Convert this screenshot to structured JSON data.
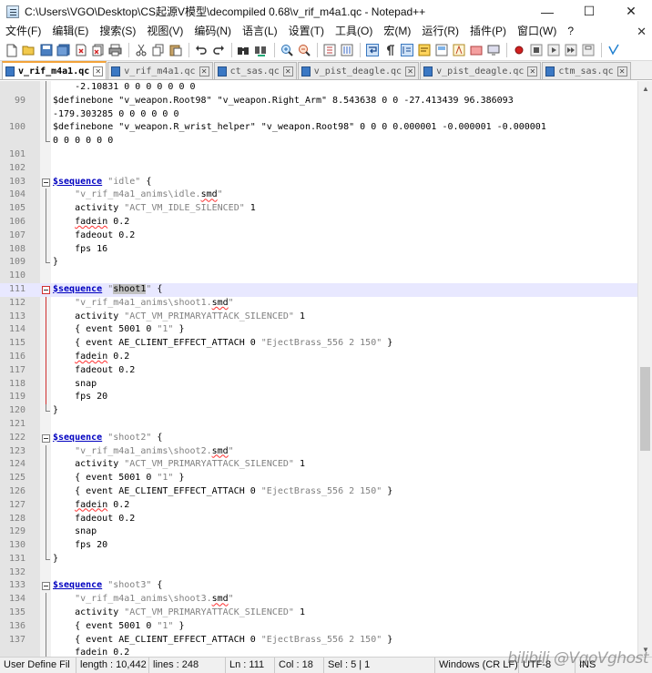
{
  "window": {
    "title": "C:\\Users\\VGO\\Desktop\\CS起源V模型\\decompiled 0.68\\v_rif_m4a1.qc - Notepad++",
    "minimize_glyph": "—",
    "maximize_glyph": "☐",
    "close_glyph": "✕"
  },
  "menu": {
    "items": [
      "文件(F)",
      "编辑(E)",
      "搜索(S)",
      "视图(V)",
      "编码(N)",
      "语言(L)",
      "设置(T)",
      "工具(O)",
      "宏(M)",
      "运行(R)",
      "插件(P)",
      "窗口(W)",
      "?"
    ],
    "close_glyph": "✕"
  },
  "toolbar": {
    "icons": [
      "new-file-icon",
      "open-file-icon",
      "save-icon",
      "save-all-icon",
      "close-icon",
      "close-all-icon",
      "print-icon",
      "cut-icon",
      "copy-icon",
      "paste-icon",
      "undo-icon",
      "redo-icon",
      "find-icon",
      "replace-icon",
      "zoom-in-icon",
      "zoom-out-icon",
      "sync-vertical-icon",
      "sync-horizontal-icon",
      "word-wrap-icon",
      "show-all-chars-icon",
      "indent-guide-icon",
      "user-lang-icon",
      "doc-map-icon",
      "function-list-icon",
      "folder-workspace-icon",
      "monitor-icon",
      "record-macro-icon",
      "stop-macro-icon",
      "play-macro-icon",
      "run-macro-multiple-icon",
      "save-macro-icon",
      "spellcheck-icon"
    ]
  },
  "tabs": [
    {
      "label": "v_rif_m4a1.qc",
      "active": true
    },
    {
      "label": "v_rif_m4a1.qc",
      "active": false
    },
    {
      "label": "ct_sas.qc",
      "active": false
    },
    {
      "label": "v_pist_deagle.qc",
      "active": false
    },
    {
      "label": "v_pist_deagle.qc",
      "active": false
    },
    {
      "label": "ctm_sas.qc",
      "active": false
    }
  ],
  "editor": {
    "lines": [
      {
        "num": "",
        "fold": "bar",
        "segs": [
          [
            "",
            "    -2.10831 0 0 0 0 0 0 0"
          ]
        ]
      },
      {
        "num": "99",
        "fold": "bar",
        "segs": [
          [
            "",
            "$definebone \"v_weapon.Root98\" \"v_weapon.Right_Arm\" 8.543638 0 0 -27.413439 96.386093"
          ]
        ]
      },
      {
        "num": "",
        "fold": "bar",
        "segs": [
          [
            "",
            "-179.303285 0 0 0 0 0 0"
          ]
        ]
      },
      {
        "num": "100",
        "fold": "bar",
        "segs": [
          [
            "",
            "$definebone \"v_weapon.R_wrist_helper\" \"v_weapon.Root98\" 0 0 0 0.000001 -0.000001 -0.000001"
          ]
        ]
      },
      {
        "num": "",
        "fold": "end",
        "segs": [
          [
            "",
            "0 0 0 0 0 0"
          ]
        ]
      },
      {
        "num": "101",
        "fold": "",
        "segs": [
          [
            "",
            ""
          ]
        ]
      },
      {
        "num": "102",
        "fold": "",
        "segs": [
          [
            "",
            ""
          ]
        ]
      },
      {
        "num": "103",
        "fold": "box",
        "segs": [
          [
            "kw",
            "$sequence"
          ],
          [
            "str",
            " \"idle\""
          ],
          [
            "",
            " {"
          ]
        ]
      },
      {
        "num": "104",
        "fold": "bar",
        "segs": [
          [
            "",
            "    "
          ],
          [
            "str",
            "\"v_rif_m4a1_anims\\idle."
          ],
          [
            "err",
            "smd"
          ],
          [
            "str",
            "\""
          ]
        ]
      },
      {
        "num": "105",
        "fold": "bar",
        "segs": [
          [
            "",
            "    activity "
          ],
          [
            "str",
            "\"ACT_VM_IDLE_SILENCED\""
          ],
          [
            "",
            " 1"
          ]
        ]
      },
      {
        "num": "106",
        "fold": "bar",
        "segs": [
          [
            "",
            "    "
          ],
          [
            "err",
            "fadein"
          ],
          [
            "",
            " 0.2"
          ]
        ]
      },
      {
        "num": "107",
        "fold": "bar",
        "segs": [
          [
            "",
            "    fadeout 0.2"
          ]
        ]
      },
      {
        "num": "108",
        "fold": "bar",
        "segs": [
          [
            "",
            "    fps 16"
          ]
        ]
      },
      {
        "num": "109",
        "fold": "end",
        "segs": [
          [
            "",
            "}"
          ]
        ]
      },
      {
        "num": "110",
        "fold": "",
        "segs": [
          [
            "",
            ""
          ]
        ]
      },
      {
        "num": "111",
        "fold": "box-red",
        "current": true,
        "segs": [
          [
            "kw",
            "$sequence"
          ],
          [
            "str",
            " \""
          ],
          [
            "sel",
            "shoot1"
          ],
          [
            "str",
            "\""
          ],
          [
            "",
            " {"
          ]
        ]
      },
      {
        "num": "112",
        "fold": "bar-red",
        "segs": [
          [
            "",
            "    "
          ],
          [
            "str",
            "\"v_rif_m4a1_anims\\shoot1."
          ],
          [
            "err",
            "smd"
          ],
          [
            "str",
            "\""
          ]
        ]
      },
      {
        "num": "113",
        "fold": "bar-red",
        "segs": [
          [
            "",
            "    activity "
          ],
          [
            "str",
            "\"ACT_VM_PRIMARYATTACK_SILENCED\""
          ],
          [
            "",
            " 1"
          ]
        ]
      },
      {
        "num": "114",
        "fold": "bar-red",
        "segs": [
          [
            "",
            "    { event 5001 0 "
          ],
          [
            "str",
            "\"1\""
          ],
          [
            "",
            " }"
          ]
        ]
      },
      {
        "num": "115",
        "fold": "bar-red",
        "segs": [
          [
            "",
            "    { event AE_CLIENT_EFFECT_ATTACH 0 "
          ],
          [
            "str",
            "\"EjectBrass_556 2 150\""
          ],
          [
            "",
            " }"
          ]
        ]
      },
      {
        "num": "116",
        "fold": "bar-red",
        "segs": [
          [
            "",
            "    "
          ],
          [
            "err",
            "fadein"
          ],
          [
            "",
            " 0.2"
          ]
        ]
      },
      {
        "num": "117",
        "fold": "bar-red",
        "segs": [
          [
            "",
            "    fadeout 0.2"
          ]
        ]
      },
      {
        "num": "118",
        "fold": "bar-red",
        "segs": [
          [
            "",
            "    snap"
          ]
        ]
      },
      {
        "num": "119",
        "fold": "bar-red",
        "segs": [
          [
            "",
            "    fps 20"
          ]
        ]
      },
      {
        "num": "120",
        "fold": "end",
        "segs": [
          [
            "",
            "}"
          ]
        ]
      },
      {
        "num": "121",
        "fold": "",
        "segs": [
          [
            "",
            ""
          ]
        ]
      },
      {
        "num": "122",
        "fold": "box",
        "segs": [
          [
            "kw",
            "$sequence"
          ],
          [
            "str",
            " \"shoot2\""
          ],
          [
            "",
            " {"
          ]
        ]
      },
      {
        "num": "123",
        "fold": "bar",
        "segs": [
          [
            "",
            "    "
          ],
          [
            "str",
            "\"v_rif_m4a1_anims\\shoot2."
          ],
          [
            "err",
            "smd"
          ],
          [
            "str",
            "\""
          ]
        ]
      },
      {
        "num": "124",
        "fold": "bar",
        "segs": [
          [
            "",
            "    activity "
          ],
          [
            "str",
            "\"ACT_VM_PRIMARYATTACK_SILENCED\""
          ],
          [
            "",
            " 1"
          ]
        ]
      },
      {
        "num": "125",
        "fold": "bar",
        "segs": [
          [
            "",
            "    { event 5001 0 "
          ],
          [
            "str",
            "\"1\""
          ],
          [
            "",
            " }"
          ]
        ]
      },
      {
        "num": "126",
        "fold": "bar",
        "segs": [
          [
            "",
            "    { event AE_CLIENT_EFFECT_ATTACH 0 "
          ],
          [
            "str",
            "\"EjectBrass_556 2 150\""
          ],
          [
            "",
            " }"
          ]
        ]
      },
      {
        "num": "127",
        "fold": "bar",
        "segs": [
          [
            "",
            "    "
          ],
          [
            "err",
            "fadein"
          ],
          [
            "",
            " 0.2"
          ]
        ]
      },
      {
        "num": "128",
        "fold": "bar",
        "segs": [
          [
            "",
            "    fadeout 0.2"
          ]
        ]
      },
      {
        "num": "129",
        "fold": "bar",
        "segs": [
          [
            "",
            "    snap"
          ]
        ]
      },
      {
        "num": "130",
        "fold": "bar",
        "segs": [
          [
            "",
            "    fps 20"
          ]
        ]
      },
      {
        "num": "131",
        "fold": "end",
        "segs": [
          [
            "",
            "}"
          ]
        ]
      },
      {
        "num": "132",
        "fold": "",
        "segs": [
          [
            "",
            ""
          ]
        ]
      },
      {
        "num": "133",
        "fold": "box",
        "segs": [
          [
            "kw",
            "$sequence"
          ],
          [
            "str",
            " \"shoot3\""
          ],
          [
            "",
            " {"
          ]
        ]
      },
      {
        "num": "134",
        "fold": "bar",
        "segs": [
          [
            "",
            "    "
          ],
          [
            "str",
            "\"v_rif_m4a1_anims\\shoot3."
          ],
          [
            "err",
            "smd"
          ],
          [
            "str",
            "\""
          ]
        ]
      },
      {
        "num": "135",
        "fold": "bar",
        "segs": [
          [
            "",
            "    activity "
          ],
          [
            "str",
            "\"ACT_VM_PRIMARYATTACK_SILENCED\""
          ],
          [
            "",
            " 1"
          ]
        ]
      },
      {
        "num": "136",
        "fold": "bar",
        "segs": [
          [
            "",
            "    { event 5001 0 "
          ],
          [
            "str",
            "\"1\""
          ],
          [
            "",
            " }"
          ]
        ]
      },
      {
        "num": "137",
        "fold": "bar",
        "segs": [
          [
            "",
            "    { event AE_CLIENT_EFFECT_ATTACH 0 "
          ],
          [
            "str",
            "\"EjectBrass_556 2 150\""
          ],
          [
            "",
            " }"
          ]
        ]
      },
      {
        "num": "",
        "fold": "bar",
        "segs": [
          [
            "",
            "    fadein 0.2"
          ]
        ]
      }
    ]
  },
  "scrollbar": {
    "up_glyph": "▲",
    "down_glyph": "▼"
  },
  "status": {
    "lang": "User Define Fil",
    "length": "length : 10,442",
    "lines": "lines : 248",
    "ln": "Ln : 111",
    "col": "Col : 18",
    "sel": "Sel : 5 | 1",
    "eol": "Windows (CR LF)",
    "encoding": "UTF-8",
    "ins": "INS"
  },
  "watermark": "bilibili @VgoVghost"
}
